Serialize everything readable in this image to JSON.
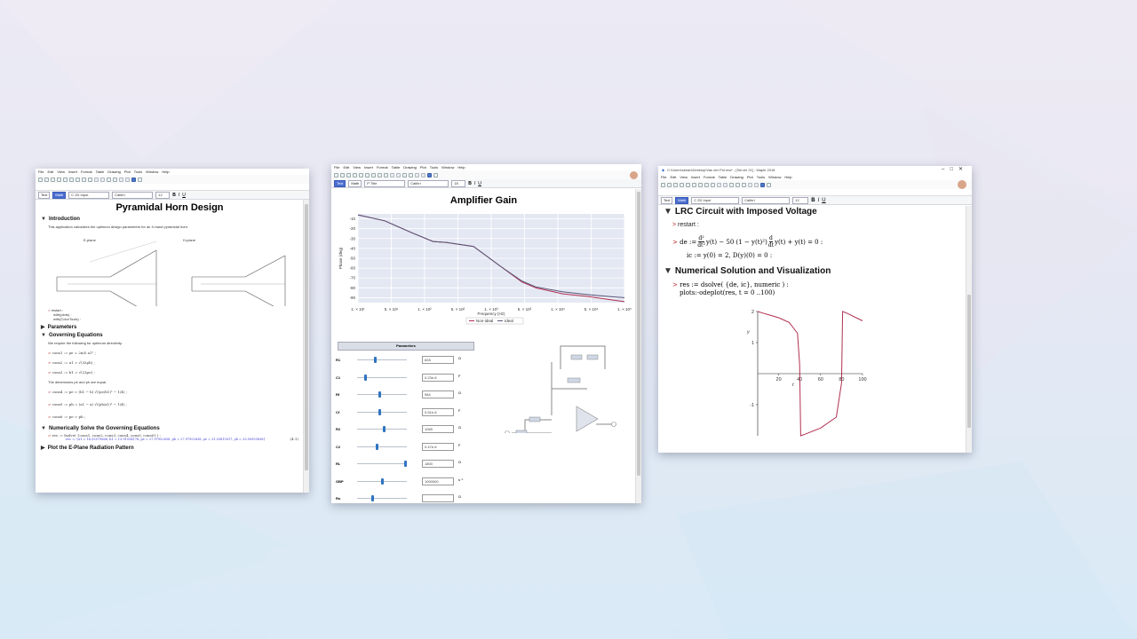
{
  "windows": {
    "left": {
      "menu": [
        "File",
        "Edit",
        "View",
        "Insert",
        "Format",
        "Table",
        "Drawing",
        "Plot",
        "Tools",
        "Window",
        "Help"
      ],
      "mode_text": "Text",
      "mode_math": "Math",
      "input_style": "C  2D Input",
      "font": "Calibri",
      "font_size": "12",
      "title": "Pyramidal Horn Design",
      "sec_intro": "Introduction",
      "intro_text": "This application calculates the optimum design parameters for an X-band pyramidal horn.",
      "eplane": "E-plane",
      "hplane": "H-plane",
      "restart_lines": [
        "restart :",
        "with(plots) :",
        "with(ColorTools) :"
      ],
      "sec_params": "Parameters",
      "sec_gov": "Governing Equations",
      "gov_text": "We require the following for optimum directivity.",
      "cons": [
        "cons1 := ρe = 2π/λ a1² ;",
        "cons2 := a1 = √(3λρh) ;",
        "cons3 := b1 = √(2λρe) ;"
      ],
      "dim_text": "The dimensions pe and ph are equal.",
      "cons_more": [
        "cons4 := pe = (b1 − b) √((ρe/b1)² − 1/4) ;",
        "cons5 := ph = (a1 − a) √((ρh/a1)² − 1/4) ;",
        "cons6 := pe = ph ;"
      ],
      "sec_solve": "Numerically Solve the Governing Equations",
      "res_line": "res := fsolve( {cons1, cons2, cons3, cons4, cons5, cons6} ) :",
      "res_value": "res := {a1 = 16.55579868, b1 = 13.91534178, pe = 27.97952838, ph = 27.97952838, ρe = 31.03815017, ρh = 33.50953838}",
      "eq_label": "(4.1)",
      "sec_plot": "Plot the E-Plane Radiation Pattern"
    },
    "middle": {
      "menu": [
        "File",
        "Edit",
        "View",
        "Insert",
        "Format",
        "Table",
        "Drawing",
        "Plot",
        "Tools",
        "Window",
        "Help"
      ],
      "mode_text": "Text",
      "mode_math": "Math",
      "input_style": "P Title",
      "font": "Calibri",
      "font_size": "18",
      "title": "Amplifier Gain",
      "ylabel": "Phase (deg)",
      "xlabel": "Frequency (Hz)",
      "legend_non_ideal": "Non-ideal",
      "legend_ideal": "Ideal",
      "params_title": "Parameters",
      "params": [
        {
          "name": "R1",
          "value": "828",
          "unit": "Ω",
          "pos": 0.35
        },
        {
          "name": "C1",
          "value": "0.23e-6",
          "unit": "F",
          "pos": 0.15
        },
        {
          "name": "Rf",
          "value": "984",
          "unit": "Ω",
          "pos": 0.45
        },
        {
          "name": "Cf",
          "value": "0.51e-6",
          "unit": "F",
          "pos": 0.45
        },
        {
          "name": "R2",
          "value": "1069",
          "unit": "Ω",
          "pos": 0.55
        },
        {
          "name": "C2",
          "value": "0.47e-6",
          "unit": "F",
          "pos": 0.4
        },
        {
          "name": "RL",
          "value": "1800",
          "unit": "Ω",
          "pos": 1.0
        },
        {
          "name": "GBP",
          "value": "1000000",
          "unit": "s⁻¹",
          "pos": 0.5
        },
        {
          "name": "Ro",
          "value": "",
          "unit": "Ω",
          "pos": 0.3
        }
      ]
    },
    "right": {
      "title_bar": "C:\\Users\\skhan\\Desktop\\Van der Pol.mw* - [Server 21] - Maple 2018",
      "menu": [
        "File",
        "Edit",
        "View",
        "Insert",
        "Format",
        "Table",
        "Drawing",
        "Plot",
        "Tools",
        "Window",
        "Help"
      ],
      "mode_text": "Text",
      "mode_math": "Math",
      "input_style": "C  2D Input",
      "font": "Calibri",
      "font_size": "12",
      "sec1": "LRC Circuit with Imposed Voltage",
      "restart": "restart :",
      "de_prefix": "de := ",
      "de_mid": " y(t) − 50 (1 − y(t)²) ",
      "de_tail": " y(t) + y(t) = 0 :",
      "ic": "ic := y(0) = 2, D(y)(0) = 0 :",
      "sec2": "Numerical Solution and Visualization",
      "res": "res := dsolve( {de, ic}, numeric ) :",
      "odeplot": "plots:-odeplot(res, t = 0 ..100)",
      "yaxis_label": "y",
      "xaxis_label": "t",
      "xticks": [
        "20",
        "40",
        "60",
        "80",
        "100"
      ],
      "yticks": [
        "2",
        "1",
        "-1"
      ]
    }
  },
  "chart_data": [
    {
      "type": "line",
      "title": "Amplifier Gain",
      "xlabel": "Frequency (Hz)",
      "ylabel": "Phase (deg)",
      "xscale": "log",
      "xlim": [
        10,
        10000
      ],
      "ylim": [
        -95,
        -5
      ],
      "yticks": [
        -10,
        -20,
        -30,
        -40,
        -50,
        -60,
        -70,
        -80,
        -90
      ],
      "xtick_labels": [
        "1. × 10¹",
        "5. × 10¹",
        "1. × 10²",
        "5. × 10²",
        "1. × 10³",
        "5. × 10³",
        "1. × 10⁴",
        "5. × 10⁴",
        "1. × 10⁵"
      ],
      "legend": "bottom",
      "series": [
        {
          "name": "Non-ideal",
          "color": "#b03050",
          "x": [
            10,
            20,
            40,
            70,
            100,
            200,
            400,
            700,
            1000,
            2000,
            4000,
            7000,
            10000
          ],
          "y": [
            -6,
            -12,
            -24,
            -33,
            -34,
            -38,
            -58,
            -74,
            -80,
            -86,
            -89,
            -92,
            -94
          ]
        },
        {
          "name": "Ideal",
          "color": "#555577",
          "x": [
            10,
            20,
            40,
            70,
            100,
            200,
            400,
            700,
            1000,
            2000,
            4000,
            7000,
            10000
          ],
          "y": [
            -6,
            -12,
            -24,
            -33,
            -34,
            -38,
            -58,
            -73,
            -79,
            -84,
            -87,
            -89,
            -90
          ]
        }
      ]
    },
    {
      "type": "line",
      "xlabel": "t",
      "ylabel": "y",
      "xlim": [
        0,
        100
      ],
      "ylim": [
        -2,
        2
      ],
      "series": [
        {
          "color": "#b03050",
          "x": [
            0,
            5,
            10,
            20,
            30,
            38,
            40,
            41,
            45,
            60,
            75,
            80,
            81,
            85,
            100
          ],
          "y": [
            2,
            1.95,
            1.9,
            1.8,
            1.65,
            1.3,
            0.3,
            -2,
            -1.95,
            -1.75,
            -1.4,
            -0.3,
            2,
            1.95,
            1.7
          ]
        }
      ]
    }
  ]
}
